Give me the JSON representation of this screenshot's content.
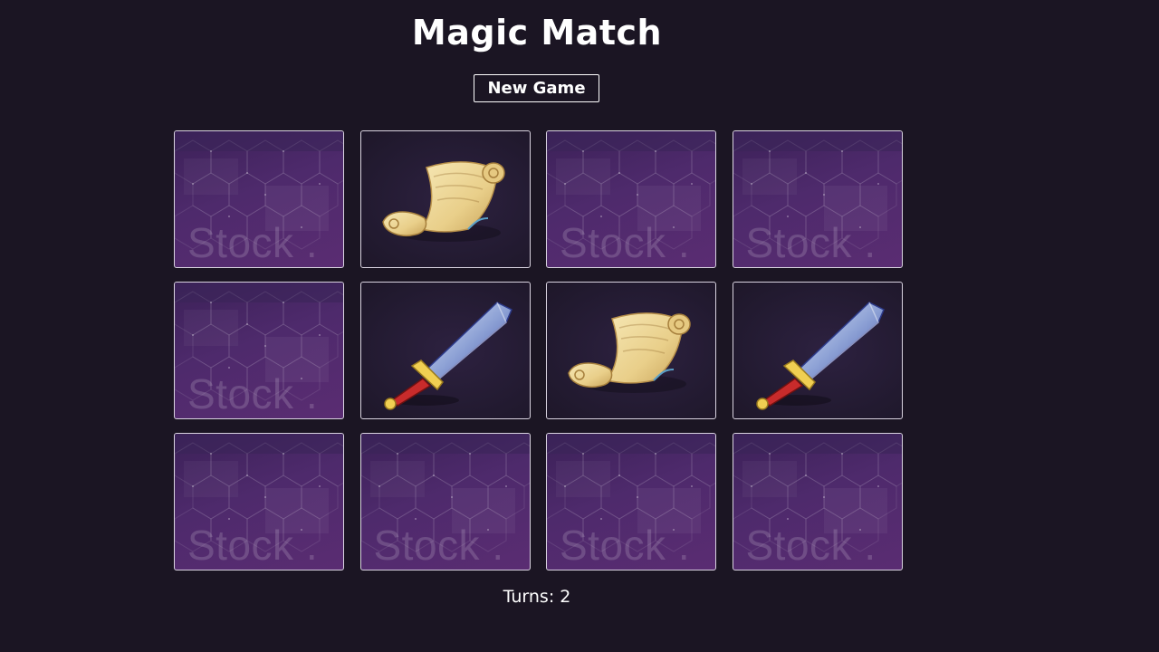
{
  "game": {
    "title": "Magic Match",
    "new_game_label": "New Game",
    "turns_label": "Turns: 2"
  },
  "cards": [
    {
      "state": "hidden",
      "image": "card-back",
      "watermark": "Stock ."
    },
    {
      "state": "revealed",
      "image": "scroll-icon"
    },
    {
      "state": "hidden",
      "image": "card-back",
      "watermark": "Stock ."
    },
    {
      "state": "hidden",
      "image": "card-back",
      "watermark": "Stock ."
    },
    {
      "state": "hidden",
      "image": "card-back",
      "watermark": "Stock ."
    },
    {
      "state": "revealed",
      "image": "sword-icon"
    },
    {
      "state": "revealed",
      "image": "scroll-icon"
    },
    {
      "state": "revealed",
      "image": "sword-icon"
    },
    {
      "state": "hidden",
      "image": "card-back",
      "watermark": "Stock ."
    },
    {
      "state": "hidden",
      "image": "card-back",
      "watermark": "Stock ."
    },
    {
      "state": "hidden",
      "image": "card-back",
      "watermark": "Stock ."
    },
    {
      "state": "hidden",
      "image": "card-back",
      "watermark": "Stock ."
    }
  ],
  "colors": {
    "background": "#1b1523",
    "card_back": "#4e2a6c",
    "card_face": "#221a30",
    "border": "#d9d3e0"
  }
}
